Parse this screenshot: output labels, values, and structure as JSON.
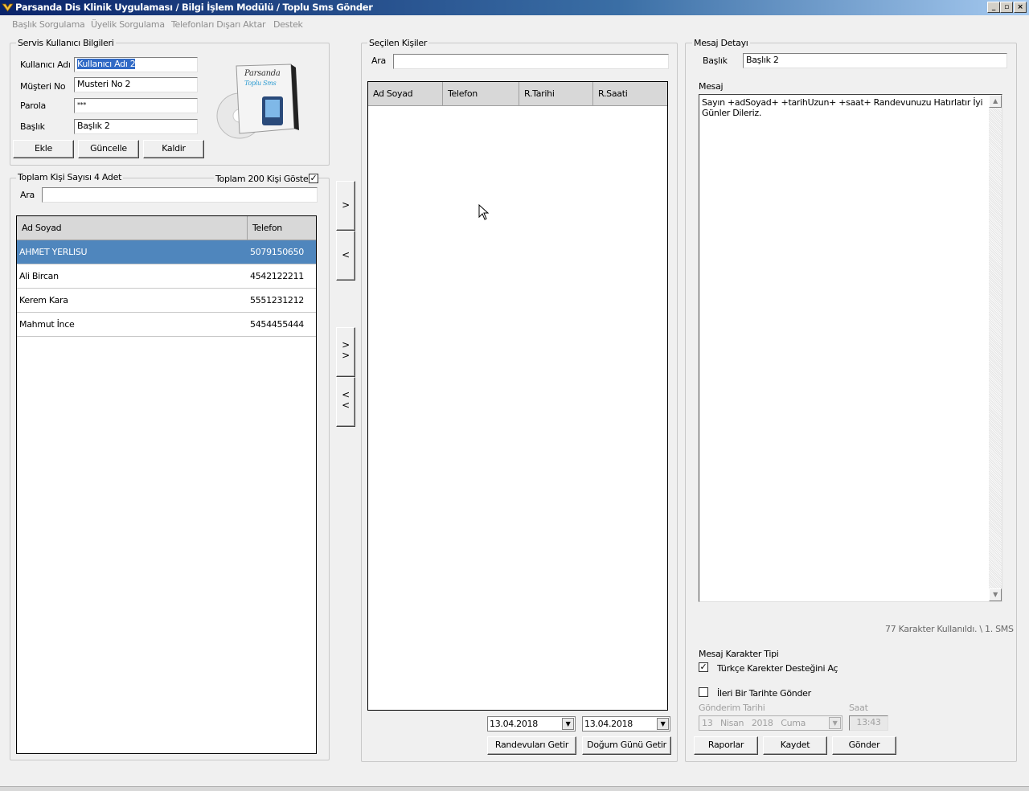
{
  "window": {
    "title": "Parsanda Dis Klinik Uygulaması / Bilgi İşlem Modülü / Toplu Sms Gönder",
    "btn_min": "_",
    "btn_max": "▫",
    "btn_close": "×"
  },
  "menu": [
    "Başlık Sorgulama",
    "Üyelik Sorgulama",
    "Telefonları Dışarı Aktar",
    "Destek"
  ],
  "service": {
    "group_label": "Servis Kullanıcı Bilgileri",
    "username_label": "Kullanıcı Adı",
    "username_value": "Kullanıcı Adı 2",
    "customer_label": "Müşteri No",
    "customer_value": "Musteri No 2",
    "password_label": "Parola",
    "password_value": "***",
    "title_label": "Başlık",
    "title_value": "Başlık 2",
    "add_button": "Ekle",
    "update_button": "Güncelle",
    "remove_button": "Kaldir",
    "logo_line1": "Parsanda",
    "logo_line2": "Toplu Sms"
  },
  "contacts": {
    "group_label": "Toplam Kişi Sayısı 4 Adet",
    "show_200_label": "Toplam 200 Kişi Göster",
    "show_200_checked": true,
    "search_label": "Ara",
    "search_value": "",
    "columns": [
      "Ad Soyad",
      "Telefon"
    ],
    "rows": [
      {
        "name": "AHMET YERLISU",
        "phone": "5079150650",
        "selected": true
      },
      {
        "name": "Ali Bircan",
        "phone": "4542122211",
        "selected": false
      },
      {
        "name": "Kerem Kara",
        "phone": "5551231212",
        "selected": false
      },
      {
        "name": "Mahmut İnce",
        "phone": "5454455444",
        "selected": false
      }
    ]
  },
  "transfer": {
    "add_one": ">",
    "remove_one": "<",
    "add_all": ">\n>",
    "remove_all": "<\n<"
  },
  "selected": {
    "group_label": "Seçilen Kişiler",
    "search_label": "Ara",
    "search_value": "",
    "columns": [
      "Ad Soyad",
      "Telefon",
      "R.Tarihi",
      "R.Saati"
    ],
    "date_from": "13.04.2018",
    "date_to": "13.04.2018",
    "appointments_button": "Randevuları Getir",
    "birthdays_button": "Doğum Günü Getir"
  },
  "message": {
    "group_label": "Mesaj Detayı",
    "title_label": "Başlık",
    "title_value": "Başlık 2",
    "body_label": "Mesaj",
    "body_value": "Sayın +adSoyad+ +tarihUzun+ +saat+ Randevunuzu Hatırlatır İyi Günler Dileriz.",
    "char_count": "77 Karakter Kullanıldı. \\ 1. SMS",
    "charset_label": "Mesaj Karakter Tipi",
    "turkish_label": "Türkçe Karekter Desteğini Aç",
    "turkish_checked": true,
    "schedule_label": "İleri Bir Tarihte Gönder",
    "schedule_checked": false,
    "send_date_label": "Gönderim Tarihi",
    "send_date_day": "13",
    "send_date_month": "Nisan",
    "send_date_year": "2018",
    "send_date_weekday": "Cuma",
    "time_label": "Saat",
    "time_value": "13:43",
    "reports_button": "Raporlar",
    "save_button": "Kaydet",
    "send_button": "Gönder"
  }
}
